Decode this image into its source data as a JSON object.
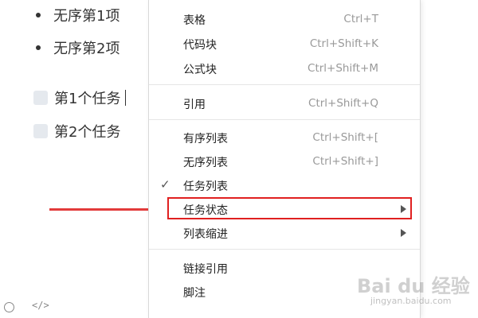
{
  "editor": {
    "bullets": [
      "无序第1项",
      "无序第2项"
    ],
    "tasks": [
      "第1个任务",
      "第2个任务"
    ]
  },
  "footer": {
    "circle_icon": "circle-icon",
    "code_icon": "</>"
  },
  "menu": {
    "items": [
      {
        "label": "表格",
        "shortcut": "Ctrl+T"
      },
      {
        "label": "代码块",
        "shortcut": "Ctrl+Shift+K"
      },
      {
        "label": "公式块",
        "shortcut": "Ctrl+Shift+M"
      },
      {
        "label": "引用",
        "shortcut": "Ctrl+Shift+Q"
      },
      {
        "label": "有序列表",
        "shortcut": "Ctrl+Shift+["
      },
      {
        "label": "无序列表",
        "shortcut": "Ctrl+Shift+]"
      },
      {
        "label": "任务列表",
        "checked": true
      },
      {
        "label": "任务状态",
        "submenu": true,
        "highlighted": true
      },
      {
        "label": "列表缩进",
        "submenu": true
      },
      {
        "label": "链接引用"
      },
      {
        "label": "脚注"
      }
    ],
    "check_glyph": "✓"
  },
  "watermark": {
    "text": "Bai du 经验",
    "sub": "jingyan.baidu.com"
  },
  "colors": {
    "highlight": "#e02020",
    "arrow": "#e23b3b"
  }
}
